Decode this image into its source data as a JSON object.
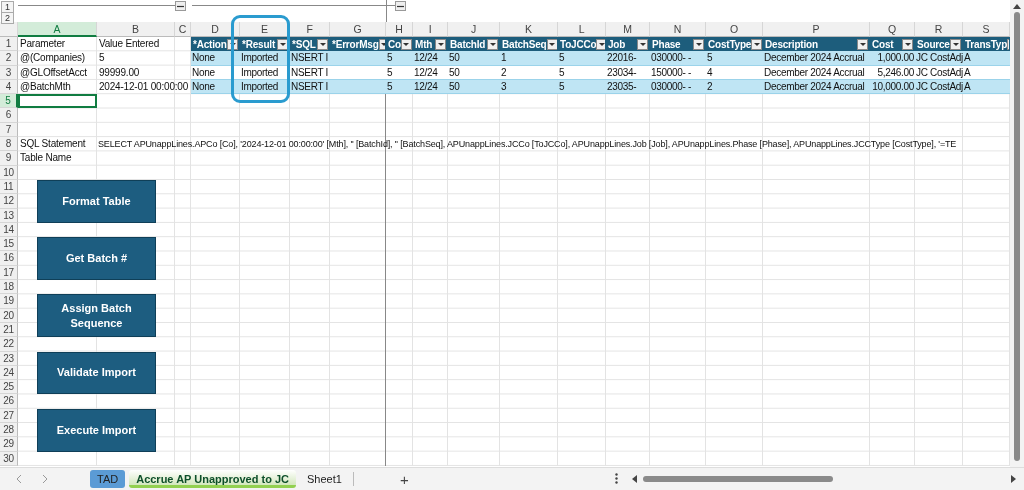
{
  "outline": {
    "levels": [
      "1",
      "2"
    ],
    "groups": [
      {
        "expanded": true
      },
      {
        "expanded": true
      }
    ]
  },
  "column_letters": [
    {
      "label": "A",
      "selected": true
    },
    {
      "label": "B",
      "selected": false
    },
    {
      "label": "C",
      "selected": false
    },
    {
      "label": "D",
      "selected": false
    },
    {
      "label": "E",
      "selected": false
    },
    {
      "label": "F",
      "selected": false
    },
    {
      "label": "G",
      "selected": false
    },
    {
      "label": "H",
      "selected": false
    },
    {
      "label": "I",
      "selected": false
    },
    {
      "label": "J",
      "selected": false
    },
    {
      "label": "K",
      "selected": false
    },
    {
      "label": "L",
      "selected": false
    },
    {
      "label": "M",
      "selected": false
    },
    {
      "label": "N",
      "selected": false
    },
    {
      "label": "O",
      "selected": false
    },
    {
      "label": "P",
      "selected": false
    },
    {
      "label": "Q",
      "selected": false
    },
    {
      "label": "R",
      "selected": false
    },
    {
      "label": "S",
      "selected": false
    }
  ],
  "row_numbers": [
    {
      "label": "1",
      "selected": false
    },
    {
      "label": "2",
      "selected": false
    },
    {
      "label": "3",
      "selected": false
    },
    {
      "label": "4",
      "selected": false
    },
    {
      "label": "5",
      "selected": true
    },
    {
      "label": "6",
      "selected": false
    },
    {
      "label": "7",
      "selected": false
    },
    {
      "label": "8",
      "selected": false
    },
    {
      "label": "9",
      "selected": false
    },
    {
      "label": "10",
      "selected": false
    },
    {
      "label": "11",
      "selected": false
    },
    {
      "label": "12",
      "selected": false
    },
    {
      "label": "13",
      "selected": false
    },
    {
      "label": "14",
      "selected": false
    },
    {
      "label": "15",
      "selected": false
    },
    {
      "label": "16",
      "selected": false
    },
    {
      "label": "17",
      "selected": false
    },
    {
      "label": "18",
      "selected": false
    },
    {
      "label": "19",
      "selected": false
    },
    {
      "label": "20",
      "selected": false
    },
    {
      "label": "21",
      "selected": false
    },
    {
      "label": "22",
      "selected": false
    },
    {
      "label": "23",
      "selected": false
    },
    {
      "label": "24",
      "selected": false
    },
    {
      "label": "25",
      "selected": false
    },
    {
      "label": "26",
      "selected": false
    },
    {
      "label": "27",
      "selected": false
    },
    {
      "label": "28",
      "selected": false
    },
    {
      "label": "29",
      "selected": false
    },
    {
      "label": "30",
      "selected": false
    }
  ],
  "params": {
    "header": [
      "Parameter",
      "Value Entered"
    ],
    "rows": [
      [
        "@(Companies)",
        "5"
      ],
      [
        "@GLOffsetAcct",
        "99999.00"
      ],
      [
        "@BatchMth",
        "2024-12-01 00:00:00"
      ]
    ]
  },
  "table": {
    "columns": [
      {
        "name": "*Action",
        "kind": "text"
      },
      {
        "name": "*Result",
        "kind": "text"
      },
      {
        "name": "*SQL",
        "kind": "text"
      },
      {
        "name": "*ErrorMsg",
        "kind": "text"
      },
      {
        "name": "Co",
        "kind": "text"
      },
      {
        "name": "Mth",
        "kind": "text"
      },
      {
        "name": "BatchId",
        "kind": "text"
      },
      {
        "name": "BatchSeq",
        "kind": "text"
      },
      {
        "name": "ToJCCo",
        "kind": "text"
      },
      {
        "name": "Job",
        "kind": "text"
      },
      {
        "name": "Phase",
        "kind": "text"
      },
      {
        "name": "CostType",
        "kind": "text"
      },
      {
        "name": "Description",
        "kind": "text"
      },
      {
        "name": "Cost",
        "kind": "number"
      },
      {
        "name": "Source",
        "kind": "text"
      },
      {
        "name": "TransTyp",
        "kind": "text"
      }
    ],
    "rows": [
      [
        "None",
        "Imported",
        "NSERT I",
        null,
        "5",
        "12/24",
        "50",
        "1",
        "5",
        "22016-",
        "030000-  -",
        "5",
        "December 2024 Accrual",
        "1,000.00",
        "JC CostAdj",
        "A"
      ],
      [
        "None",
        "Imported",
        "NSERT I",
        null,
        "5",
        "12/24",
        "50",
        "2",
        "5",
        "23034-",
        "150000-  -",
        "4",
        "December 2024 Accrual",
        "5,246.00",
        "JC CostAdj",
        "A"
      ],
      [
        "None",
        "Imported",
        "NSERT I",
        null,
        "5",
        "12/24",
        "50",
        "3",
        "5",
        "23035-",
        "030000-  -",
        "2",
        "December 2024 Accrual",
        "10,000.00",
        "JC CostAdj",
        "A"
      ]
    ]
  },
  "sql_rows": [
    {
      "label": "SQL Statement",
      "value": "SELECT APUnappLines.APCo [Co], '2024-12-01 00:00:00' [Mth], '' [BatchId], '' [BatchSeq], APUnappLines.JCCo [ToJCCo], APUnappLines.Job [Job], APUnappLines.Phase [Phase], APUnappLines.JCCType [CostType], '=TE"
    },
    {
      "label": "Table Name"
    }
  ],
  "buttons": [
    "Format Table",
    "Get Batch #",
    "Assign Batch Sequence",
    "Validate Import",
    "Execute Import"
  ],
  "sheet_tabs": [
    {
      "label": "TAD",
      "selected": false,
      "color": "#5b9bd5"
    },
    {
      "label": "Accrue AP Unapproved to JC",
      "selected": true,
      "color": "#92d050"
    },
    {
      "label": "Sheet1",
      "selected": false
    }
  ],
  "add_sheet": "+"
}
